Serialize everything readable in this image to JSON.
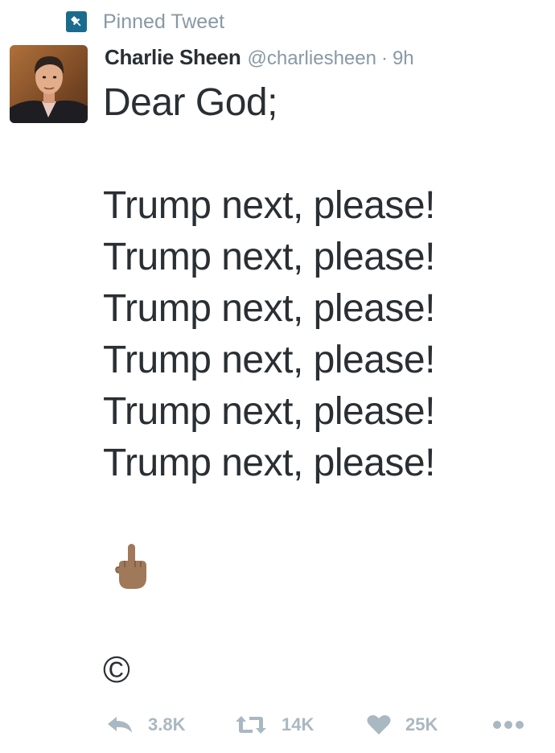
{
  "pinned": {
    "label": "Pinned Tweet"
  },
  "author": {
    "name": "Charlie Sheen",
    "handle": "@charliesheen",
    "separator": "·",
    "time": "9h"
  },
  "tweet": {
    "lines": [
      "Dear God;",
      "",
      "Trump next, please!",
      "Trump next, please!",
      "Trump next, please!",
      "Trump next, please!",
      "Trump next, please!",
      "Trump next, please!"
    ],
    "emoji": "middle-finger-emoji",
    "symbol": "©"
  },
  "actions": {
    "reply_count": "3.8K",
    "retweet_count": "14K",
    "like_count": "25K"
  },
  "colors": {
    "pin_badge": "#1b6b8f",
    "muted_text": "#8899a6",
    "action_gray": "#aab8c2",
    "body_text": "#292f33",
    "emoji_skin": "#a0785a"
  }
}
